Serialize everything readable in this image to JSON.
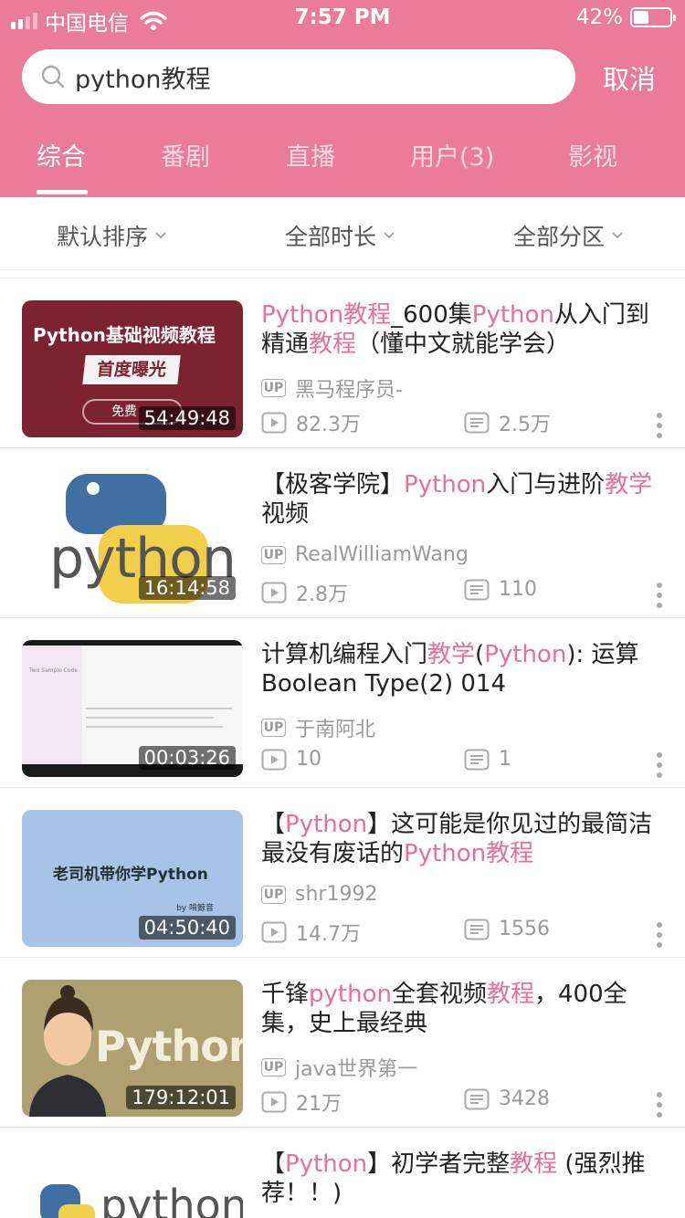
{
  "status_bar": {
    "carrier": "中国电信",
    "time": "7:57 PM",
    "battery_text": "42%",
    "battery_level": 0.42
  },
  "search": {
    "query": "python教程",
    "cancel_label": "取消"
  },
  "tabs": [
    "综合",
    "番剧",
    "直播",
    "用户(3)",
    "影视"
  ],
  "filters": [
    "默认排序",
    "全部时长",
    "全部分区"
  ],
  "colors": {
    "header": "#ea7b9b",
    "highlight": "#e86f96"
  },
  "results": [
    {
      "title_parts": [
        {
          "text": "Python教程",
          "hl": true
        },
        {
          "text": "_600集",
          "hl": false
        },
        {
          "text": "Python",
          "hl": true
        },
        {
          "text": "从入门到精通",
          "hl": false
        },
        {
          "text": "教程",
          "hl": true
        },
        {
          "text": "（懂中文就能学会）",
          "hl": false
        }
      ],
      "uploader": "黑马程序员-",
      "plays": "82.3万",
      "danmaku": "2.5万",
      "duration": "54:49:48",
      "thumb_text": [
        "Python基础视频教程",
        "首度曝光",
        "免费"
      ]
    },
    {
      "title_parts": [
        {
          "text": "【极客学院】",
          "hl": false
        },
        {
          "text": "Python",
          "hl": true
        },
        {
          "text": "入门与进阶",
          "hl": false
        },
        {
          "text": "教学",
          "hl": true
        },
        {
          "text": "视频",
          "hl": false
        }
      ],
      "uploader": "RealWilliamWang",
      "plays": "2.8万",
      "danmaku": "110",
      "duration": "16:14:58",
      "thumb_text": [
        "python"
      ]
    },
    {
      "title_parts": [
        {
          "text": "计算机编程入门",
          "hl": false
        },
        {
          "text": "教学",
          "hl": true
        },
        {
          "text": "(",
          "hl": false
        },
        {
          "text": "Python",
          "hl": true
        },
        {
          "text": "): 运算Boolean Type(2) 014",
          "hl": false
        }
      ],
      "uploader": "于南阿北",
      "plays": "10",
      "danmaku": "1",
      "duration": "00:03:26",
      "thumb_text": [
        "Two Sample Code"
      ]
    },
    {
      "title_parts": [
        {
          "text": "【",
          "hl": false
        },
        {
          "text": "Python",
          "hl": true
        },
        {
          "text": "】这可能是你见过的最简洁最没有废话的",
          "hl": false
        },
        {
          "text": "Python教程",
          "hl": true
        }
      ],
      "uploader": "shr1992",
      "plays": "14.7万",
      "danmaku": "1556",
      "duration": "04:50:40",
      "thumb_text": [
        "老司机带你学Python",
        "by 啃鲸音"
      ]
    },
    {
      "title_parts": [
        {
          "text": "千锋",
          "hl": false
        },
        {
          "text": "python",
          "hl": true
        },
        {
          "text": "全套视频",
          "hl": false
        },
        {
          "text": "教程",
          "hl": true
        },
        {
          "text": "，400全集，史上最经典",
          "hl": false
        }
      ],
      "uploader": "java世界第一",
      "plays": "21万",
      "danmaku": "3428",
      "duration": "179:12:01",
      "thumb_text": [
        "Python"
      ]
    },
    {
      "title_parts": [
        {
          "text": "【",
          "hl": false
        },
        {
          "text": "Python",
          "hl": true
        },
        {
          "text": "】初学者完整",
          "hl": false
        },
        {
          "text": "教程",
          "hl": true
        },
        {
          "text": " (强烈推荐！！)",
          "hl": false
        }
      ],
      "thumb_text": [
        "python"
      ]
    }
  ]
}
